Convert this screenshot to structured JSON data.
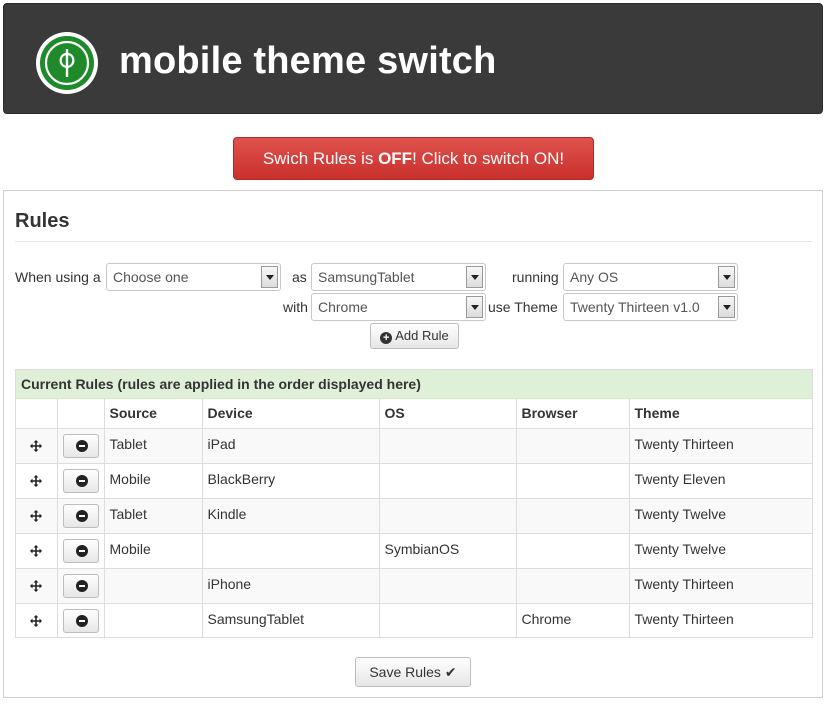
{
  "app": {
    "title": "mobile theme switch",
    "logo_icon": "phi-logo-icon",
    "brand_green": "#1e8a2a",
    "header_bg": "#3a3a3a"
  },
  "switch": {
    "text_before": "Swich Rules is ",
    "state": "OFF",
    "text_after": "! Click to switch ON!",
    "color": "#d9534f"
  },
  "rules": {
    "title": "Rules",
    "form": {
      "when_using_label": "When using a",
      "source_value": "Choose one",
      "as_label": "as",
      "device_value": "SamsungTablet",
      "running_label": "running",
      "os_value": "Any OS",
      "with_label": "with",
      "browser_value": "Chrome",
      "use_theme_label": "use Theme",
      "theme_value": "Twenty Thirteen v1.0",
      "add_rule_label": "Add Rule",
      "add_icon": "plus-circle-icon"
    },
    "current": {
      "heading": "Current Rules (rules are applied in the order displayed here)",
      "heading_bg": "#dff0d8",
      "columns": [
        "",
        "",
        "Source",
        "Device",
        "OS",
        "Browser",
        "Theme"
      ],
      "row_icons": {
        "move": "move-icon",
        "delete": "minus-circle-icon"
      },
      "rows": [
        {
          "source": "Tablet",
          "device": "iPad",
          "os": "",
          "browser": "",
          "theme": "Twenty Thirteen"
        },
        {
          "source": "Mobile",
          "device": "BlackBerry",
          "os": "",
          "browser": "",
          "theme": "Twenty Eleven"
        },
        {
          "source": "Tablet",
          "device": "Kindle",
          "os": "",
          "browser": "",
          "theme": "Twenty Twelve"
        },
        {
          "source": "Mobile",
          "device": "",
          "os": "SymbianOS",
          "browser": "",
          "theme": "Twenty Twelve"
        },
        {
          "source": "",
          "device": "iPhone",
          "os": "",
          "browser": "",
          "theme": "Twenty Thirteen"
        },
        {
          "source": "",
          "device": "SamsungTablet",
          "os": "",
          "browser": "Chrome",
          "theme": "Twenty Thirteen"
        }
      ]
    },
    "save_label": "Save Rules",
    "save_icon": "checkmark-icon"
  }
}
